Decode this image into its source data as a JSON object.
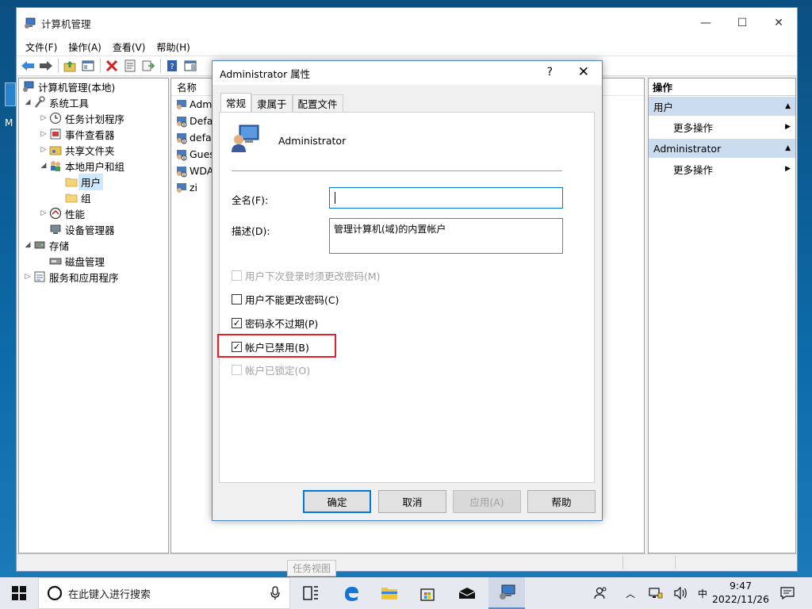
{
  "window": {
    "title": "计算机管理",
    "controls": {
      "minimize": "—",
      "maximize": "☐",
      "close": "✕"
    }
  },
  "menu": [
    "文件(F)",
    "操作(A)",
    "查看(V)",
    "帮助(H)"
  ],
  "tree": {
    "root": "计算机管理(本地)",
    "system_tools": "系统工具",
    "task_scheduler": "任务计划程序",
    "event_viewer": "事件查看器",
    "shared_folders": "共享文件夹",
    "local_users_groups": "本地用户和组",
    "users": "用户",
    "groups": "组",
    "performance": "性能",
    "device_manager": "设备管理器",
    "storage": "存储",
    "disk_management": "磁盘管理",
    "services_apps": "服务和应用程序"
  },
  "list": {
    "header": "名称",
    "rows": [
      "Admi",
      "Defa",
      "defau",
      "Gues",
      "WDA",
      "zi"
    ]
  },
  "actions": {
    "title": "操作",
    "section_users": "用户",
    "section_admin": "Administrator",
    "more_actions": "更多操作"
  },
  "tooltip": "任务视图",
  "dialog": {
    "title": "Administrator 属性",
    "help": "?",
    "close": "✕",
    "tabs": [
      "常规",
      "隶属于",
      "配置文件"
    ],
    "user_name": "Administrator",
    "fullname_label": "全名(F):",
    "fullname_value": "",
    "description_label": "描述(D):",
    "description_value": "管理计算机(域)的内置帐户",
    "checkboxes": {
      "must_change": {
        "label": "用户下次登录时须更改密码(M)",
        "checked": false,
        "disabled": true
      },
      "cannot_change": {
        "label": "用户不能更改密码(C)",
        "checked": false,
        "disabled": false
      },
      "never_expires": {
        "label": "密码永不过期(P)",
        "checked": true,
        "disabled": false
      },
      "disabled": {
        "label": "帐户已禁用(B)",
        "checked": true,
        "disabled": false
      },
      "locked": {
        "label": "帐户已锁定(O)",
        "checked": false,
        "disabled": true
      }
    },
    "check_mark": "✓",
    "buttons": {
      "ok": "确定",
      "cancel": "取消",
      "apply": "应用(A)",
      "help": "帮助"
    }
  },
  "taskbar": {
    "search_placeholder": "在此键入进行搜索",
    "ime": "中",
    "time": "9:47",
    "date": "2022/11/26"
  },
  "desktop": {
    "icon_label": "M"
  }
}
